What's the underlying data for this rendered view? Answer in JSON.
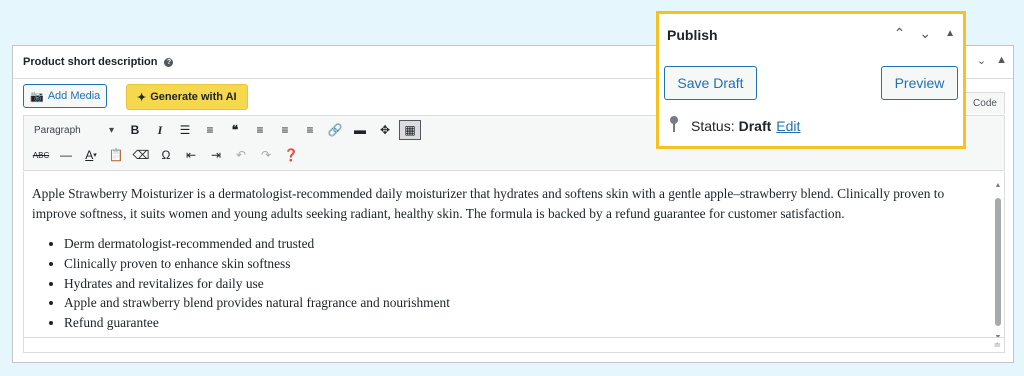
{
  "postbox": {
    "title": "Product short description",
    "help_icon": "?"
  },
  "editor": {
    "add_media_label": "Add Media",
    "generate_ai_label": "Generate with AI",
    "code_tab_label": "Code",
    "format_select": "Paragraph"
  },
  "toolbar": {
    "row1_icons": [
      "bold-icon",
      "italic-icon",
      "bullet-list-icon",
      "numbered-list-icon",
      "blockquote-icon",
      "align-left-icon",
      "align-center-icon",
      "align-right-icon",
      "link-icon",
      "read-more-icon",
      "fullscreen-icon",
      "toolbar-toggle-icon"
    ],
    "row2_icons": [
      "strikethrough-icon",
      "horizontal-line-icon",
      "text-color-icon",
      "paste-text-icon",
      "clear-formatting-icon",
      "special-character-icon",
      "outdent-icon",
      "indent-icon",
      "undo-icon",
      "redo-icon",
      "help-icon"
    ]
  },
  "content": {
    "paragraph": "Apple Strawberry Moisturizer is a dermatologist-recommended daily moisturizer that hydrates and softens skin with a gentle apple–strawberry blend. Clinically proven to improve softness, it suits women and young adults seeking radiant, healthy skin. The formula is backed by a refund guarantee for customer satisfaction.",
    "bullets": [
      "Derm dermatologist-recommended and trusted",
      "Clinically proven to enhance skin softness",
      "Hydrates and revitalizes for daily use",
      "Apple and strawberry blend provides natural fragrance and nourishment",
      "Refund guarantee"
    ]
  },
  "publish": {
    "title": "Publish",
    "save_draft_label": "Save Draft",
    "preview_label": "Preview",
    "status_label": "Status:",
    "status_value": "Draft",
    "edit_link": "Edit"
  },
  "colors": {
    "accent": "#2271b1",
    "highlight_border": "#f4c221",
    "ai_button": "#f6d84e",
    "background": "#e6f6fd"
  }
}
